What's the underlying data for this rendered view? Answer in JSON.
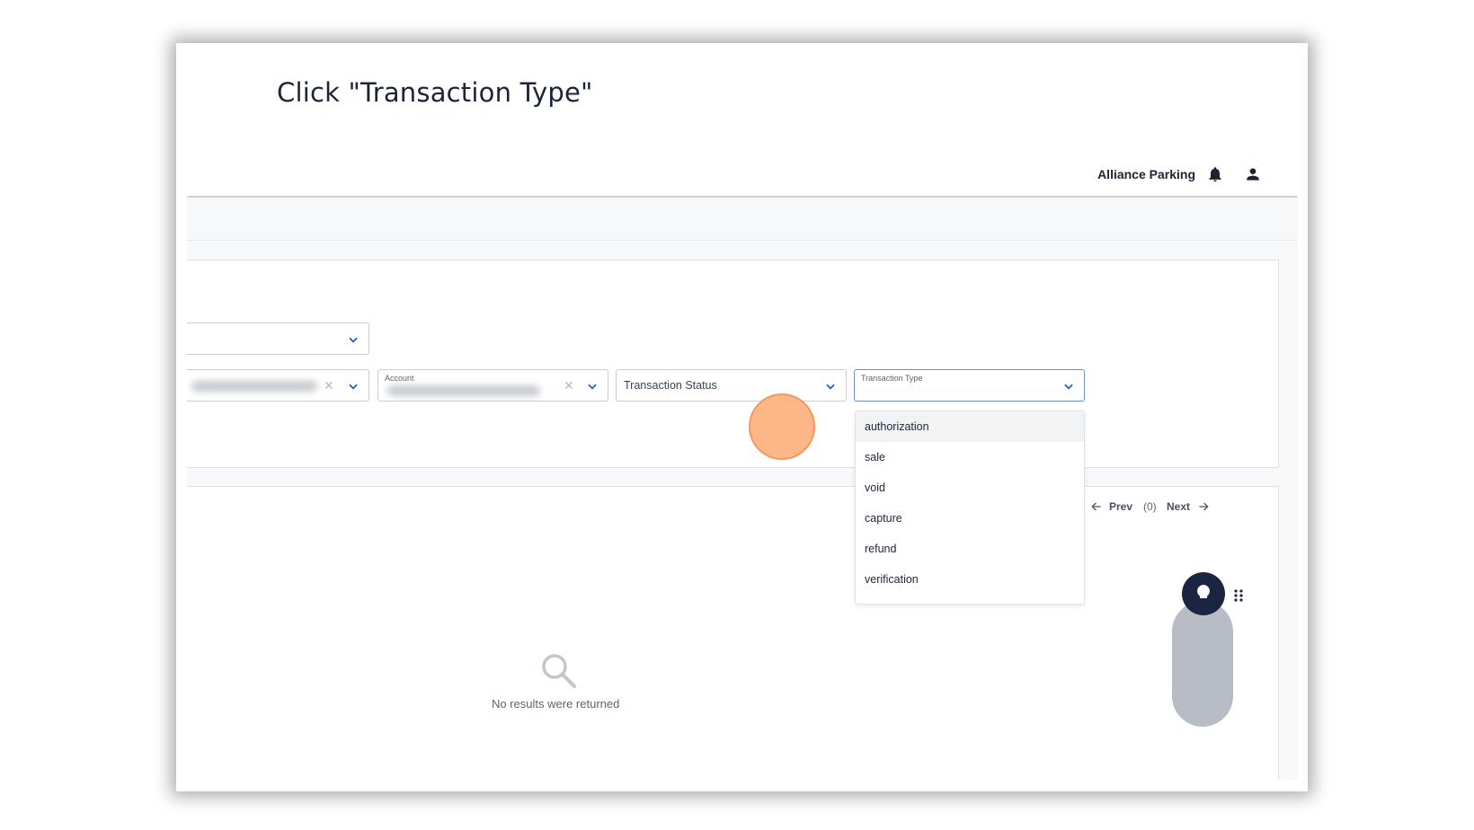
{
  "instruction": "Click \"Transaction Type\"",
  "header": {
    "org_name": "Alliance Parking"
  },
  "filters": {
    "account": {
      "label": "Account"
    },
    "transaction_status": {
      "placeholder": "Transaction Status"
    },
    "transaction_type": {
      "label": "Transaction Type"
    }
  },
  "dropdown": {
    "options": [
      "authorization",
      "sale",
      "void",
      "capture",
      "refund",
      "verification"
    ]
  },
  "pager": {
    "prev": "Prev",
    "count": "(0)",
    "next": "Next"
  },
  "results": {
    "empty_message": "No results were returned"
  },
  "colors": {
    "accent": "#1f5bd1",
    "highlight": "#f9a66c",
    "fab": "#1b2541"
  }
}
